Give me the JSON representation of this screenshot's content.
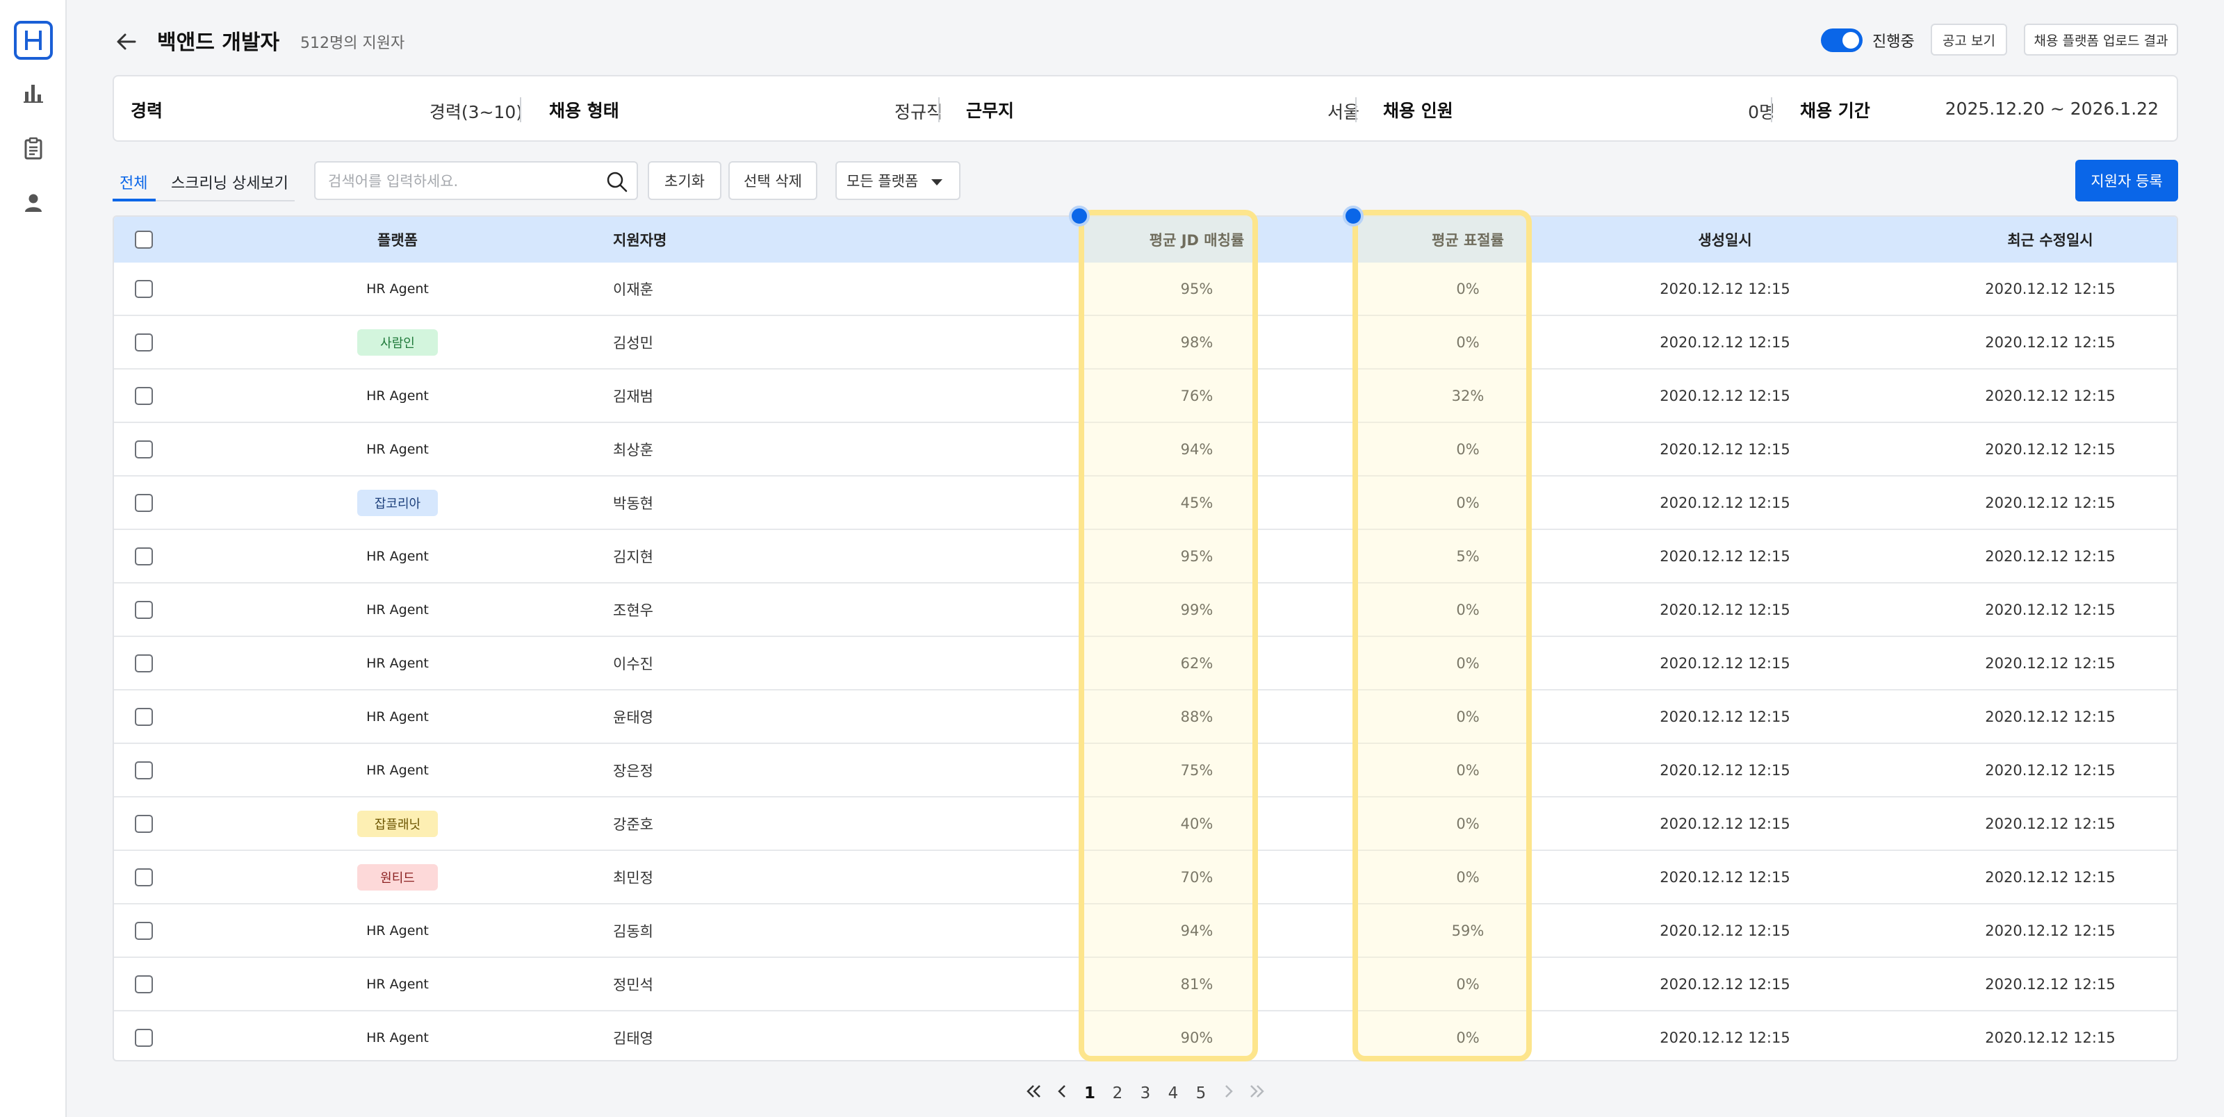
{
  "app": {
    "logo_letter": "H"
  },
  "sidebar": {
    "items": [
      {
        "icon": "bar-chart-icon"
      },
      {
        "icon": "clipboard-icon"
      },
      {
        "icon": "user-icon"
      }
    ]
  },
  "header": {
    "title": "백앤드 개발자",
    "applicant_count": "512명의 지원자",
    "status_label": "진행중",
    "view_posting": "공고 보기",
    "upload_result": "채용 플랫폼 업로드 결과"
  },
  "info": {
    "experience_label": "경력",
    "experience_value": "경력(3~10)",
    "employment_label": "채용 형태",
    "employment_value": "정규직",
    "location_label": "근무지",
    "location_value": "서울",
    "headcount_label": "채용 인원",
    "headcount_value": "0명",
    "period_label": "채용 기간",
    "period_value": "2025.12.20 ~ 2026.1.22"
  },
  "toolbar": {
    "tab_all": "전체",
    "tab_screening": "스크리닝 상세보기",
    "search_placeholder": "검색어를 입력하세요.",
    "reset": "초기화",
    "delete_selected": "선택 삭제",
    "platform_filter": "모든 플랫폼",
    "register": "지원자 등록"
  },
  "table": {
    "headers": {
      "platform": "플랫폼",
      "name": "지원자명",
      "jd_match": "평균 JD 매칭률",
      "plagiarism": "평균 표절률",
      "created": "생성일시",
      "modified": "최근 수정일시"
    },
    "rows": [
      {
        "platform": "HR Agent",
        "name": "이재훈",
        "jd": "95%",
        "plag": "0%",
        "created": "2020.12.12 12:15",
        "modified": "2020.12.12 12:15"
      },
      {
        "platform": "사람인",
        "name": "김성민",
        "jd": "98%",
        "plag": "0%",
        "created": "2020.12.12 12:15",
        "modified": "2020.12.12 12:15"
      },
      {
        "platform": "HR Agent",
        "name": "김재범",
        "jd": "76%",
        "plag": "32%",
        "created": "2020.12.12 12:15",
        "modified": "2020.12.12 12:15"
      },
      {
        "platform": "HR Agent",
        "name": "최상훈",
        "jd": "94%",
        "plag": "0%",
        "created": "2020.12.12 12:15",
        "modified": "2020.12.12 12:15"
      },
      {
        "platform": "잡코리아",
        "name": "박동현",
        "jd": "45%",
        "plag": "0%",
        "created": "2020.12.12 12:15",
        "modified": "2020.12.12 12:15"
      },
      {
        "platform": "HR Agent",
        "name": "김지현",
        "jd": "95%",
        "plag": "5%",
        "created": "2020.12.12 12:15",
        "modified": "2020.12.12 12:15"
      },
      {
        "platform": "HR Agent",
        "name": "조현우",
        "jd": "99%",
        "plag": "0%",
        "created": "2020.12.12 12:15",
        "modified": "2020.12.12 12:15"
      },
      {
        "platform": "HR Agent",
        "name": "이수진",
        "jd": "62%",
        "plag": "0%",
        "created": "2020.12.12 12:15",
        "modified": "2020.12.12 12:15"
      },
      {
        "platform": "HR Agent",
        "name": "윤태영",
        "jd": "88%",
        "plag": "0%",
        "created": "2020.12.12 12:15",
        "modified": "2020.12.12 12:15"
      },
      {
        "platform": "HR Agent",
        "name": "장은정",
        "jd": "75%",
        "plag": "0%",
        "created": "2020.12.12 12:15",
        "modified": "2020.12.12 12:15"
      },
      {
        "platform": "잡플래닛",
        "name": "강준호",
        "jd": "40%",
        "plag": "0%",
        "created": "2020.12.12 12:15",
        "modified": "2020.12.12 12:15"
      },
      {
        "platform": "원티드",
        "name": "최민정",
        "jd": "70%",
        "plag": "0%",
        "created": "2020.12.12 12:15",
        "modified": "2020.12.12 12:15"
      },
      {
        "platform": "HR Agent",
        "name": "김동희",
        "jd": "94%",
        "plag": "59%",
        "created": "2020.12.12 12:15",
        "modified": "2020.12.12 12:15"
      },
      {
        "platform": "HR Agent",
        "name": "정민석",
        "jd": "81%",
        "plag": "0%",
        "created": "2020.12.12 12:15",
        "modified": "2020.12.12 12:15"
      },
      {
        "platform": "HR Agent",
        "name": "김태영",
        "jd": "90%",
        "plag": "0%",
        "created": "2020.12.12 12:15",
        "modified": "2020.12.12 12:15"
      }
    ]
  },
  "platform_colors": {
    "사람인": {
      "bg": "#d3f5dd",
      "fg": "#1f7a3a"
    },
    "잡코리아": {
      "bg": "#d6e7fd",
      "fg": "#1c3f7a"
    },
    "잡플래닛": {
      "bg": "#fdefb3",
      "fg": "#6b5400"
    },
    "원티드": {
      "bg": "#fdd9d9",
      "fg": "#8a1f1f"
    }
  },
  "colors": {
    "accent": "#0a66e8",
    "highlight": "#fde58c",
    "header_bg": "#d6e7fd"
  },
  "pagination": {
    "pages": [
      "1",
      "2",
      "3",
      "4",
      "5"
    ],
    "current": "1"
  }
}
